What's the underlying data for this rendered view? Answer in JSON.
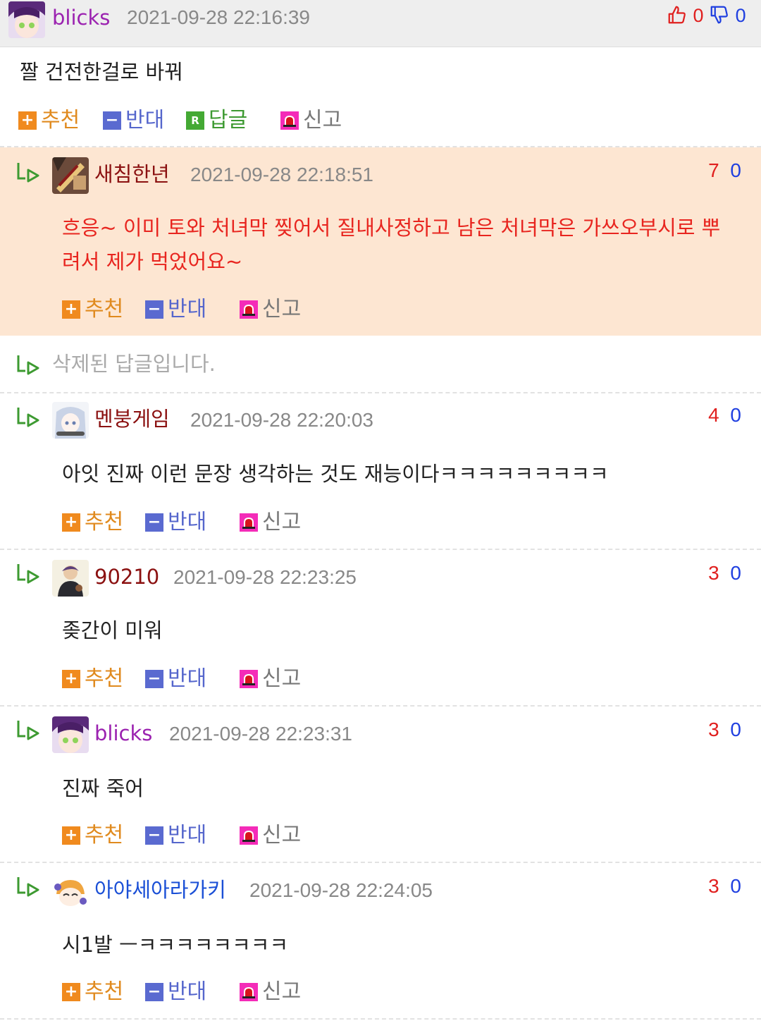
{
  "post": {
    "author": "blicks",
    "date": "2021-09-28 22:16:39",
    "likes": "0",
    "dislikes": "0",
    "body": "짤 건전한걸로 바꿔",
    "actions": {
      "recommend": "추천",
      "oppose": "반대",
      "reply": "답글",
      "report": "신고"
    },
    "reply_icon_letter": "R"
  },
  "labels": {
    "recommend": "추천",
    "oppose": "반대",
    "report": "신고",
    "plus": "+",
    "minus": "−"
  },
  "comments": [
    {
      "author": "새침한년",
      "author_color": "#8b1111",
      "date": "2021-09-28 22:18:51",
      "up": "7",
      "down": "0",
      "body_line1": "흐응~ 이미 토와 처녀막 찢어서 질내사정하고 남은 처녀막은 가쓰오부시로 뿌",
      "body_line2": "려서 제가 먹었어요~"
    },
    {
      "deleted_text": "삭제된 답글입니다."
    },
    {
      "author": "멘붕게임",
      "author_color": "#8b1111",
      "date": "2021-09-28 22:20:03",
      "up": "4",
      "down": "0",
      "body": "아잇 진짜 이런 문장 생각하는 것도 재능이다ㅋㅋㅋㅋㅋㅋㅋㅋㅋ"
    },
    {
      "author": "90210",
      "author_color": "#8b1111",
      "date": "2021-09-28 22:23:25",
      "up": "3",
      "down": "0",
      "body": "좆간이 미워"
    },
    {
      "author": "blicks",
      "author_color": "#9b22b0",
      "date": "2021-09-28 22:23:31",
      "up": "3",
      "down": "0",
      "body": "진짜 죽어"
    },
    {
      "author": "아야세아라가키",
      "author_color": "#1a4fd6",
      "date": "2021-09-28 22:24:05",
      "up": "3",
      "down": "0",
      "body": "시1발 ㅡㅋㅋㅋㅋㅋㅋㅋㅋ"
    }
  ],
  "colors": {
    "recommend": "#f08a1e",
    "oppose": "#5a6ad0",
    "reply": "#44a934",
    "report": "#f42bb8",
    "up": "#e0201f",
    "down": "#1f3fe0"
  },
  "icons": {
    "like": "thumbs-up-icon",
    "dislike": "thumbs-down-icon",
    "reply_arrow": "reply-arrow-icon",
    "report": "siren-icon"
  }
}
